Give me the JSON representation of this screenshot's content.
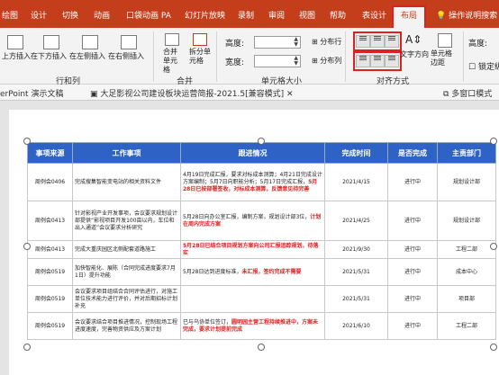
{
  "ribbon_tabs": {
    "items": [
      "绘图",
      "设计",
      "切换",
      "动画",
      "口袋动画 PA",
      "幻灯片放映",
      "录制",
      "审阅",
      "视图",
      "帮助",
      "表设计"
    ],
    "active": "布局",
    "tell_me": "操作说明搜索"
  },
  "ribbon": {
    "rows_cols": {
      "insert_above": "上方插入",
      "insert_below": "在下方插入",
      "insert_left": "在左侧插入",
      "insert_right": "在右侧插入",
      "group": "行和列"
    },
    "merge": {
      "merge_cells": "合并单元格",
      "split_cells": "拆分单元格",
      "group": "合并"
    },
    "cell_size": {
      "height_label": "高度:",
      "width_label": "宽度:",
      "height_value": "",
      "width_value": "",
      "distribute_rows": "分布行",
      "distribute_cols": "分布列",
      "group": "单元格大小"
    },
    "alignment": {
      "text_direction": "文字方向",
      "cell_margins": "单元格边距",
      "group": "对齐方式"
    },
    "arrange": {
      "height_label": "高度:",
      "lock_ratio": "锁定纵"
    }
  },
  "doc_tabs": {
    "tab1": "erPoint 演示文稿",
    "tab2": "大足影视公司建设板块运营简报-2021.5[兼容模式]",
    "tab3": "多窗口模式"
  },
  "table": {
    "headers": [
      "事项来源",
      "工作事项",
      "跟进情况",
      "完成时间",
      "是否完成",
      "主责部门"
    ],
    "rows": [
      {
        "source": "周例会0406",
        "task": "完成搜集智能变电站的相关资料文件",
        "progress": "4月19日完成汇报，要求对标成本测算；4月21日完成设计方案编制；5月7日向职能分析；5月17日完成汇报，",
        "progress_red": "5月28日已按部署签收，对标成本测算，反馈意见待完善",
        "deadline": "2021/4/15",
        "done": "进行中",
        "dept": "规划设计部"
      },
      {
        "source": "周例会0413",
        "task": "针对影视产业开发事项，会议要求规划设计部提供“影视项目开发100亩以内，车位和出入通道”会议要求分析研究",
        "progress": "5月28日向办公室汇报，编制方案，规划设计部3位，",
        "progress_red": "计划在周内完成方案",
        "deadline": "2021/4/25",
        "done": "进行中",
        "dept": "规划设计部"
      },
      {
        "source": "周例会0413",
        "task": "完成大重庆园区北侧配套道路施工",
        "progress": "",
        "progress_red": "5月28日已结合项目规划方案向公司汇报追踪规划，待落实",
        "deadline": "2021/9/30",
        "done": "进行中",
        "dept": "工程二部"
      },
      {
        "source": "周例会0519",
        "task": "加快智能化、展陈（合同完成进度要求7月1日）提升功能",
        "progress": "5月28日达到进度标准，",
        "progress_red": "未汇报，签约完成不需要",
        "deadline": "2021/5/31",
        "done": "进行中",
        "dept": "成本中心"
      },
      {
        "source": "周例会0519",
        "task": "会议要求项目组结合合同评估进行，对施工单位技术能力进行评价，并对后期招标计划补充",
        "progress": "",
        "progress_red": "",
        "deadline": "2021/5/31",
        "done": "进行中",
        "dept": "项目部"
      },
      {
        "source": "周例会0519",
        "task": "会议要求结合项目推进情况，控制现场工程进度速度，完善物资供应及方案计划",
        "progress": "已与乌协单位签订，",
        "progress_red": "圆明园主营工程持续推进中，方案未完成，要求计划提前完成",
        "deadline": "2021/6/10",
        "done": "进行中",
        "dept": "工程二部"
      }
    ]
  },
  "colors": {
    "tab_bar": "#c43e1c",
    "table_header": "#2e62c4",
    "highlight": "#e02020"
  }
}
